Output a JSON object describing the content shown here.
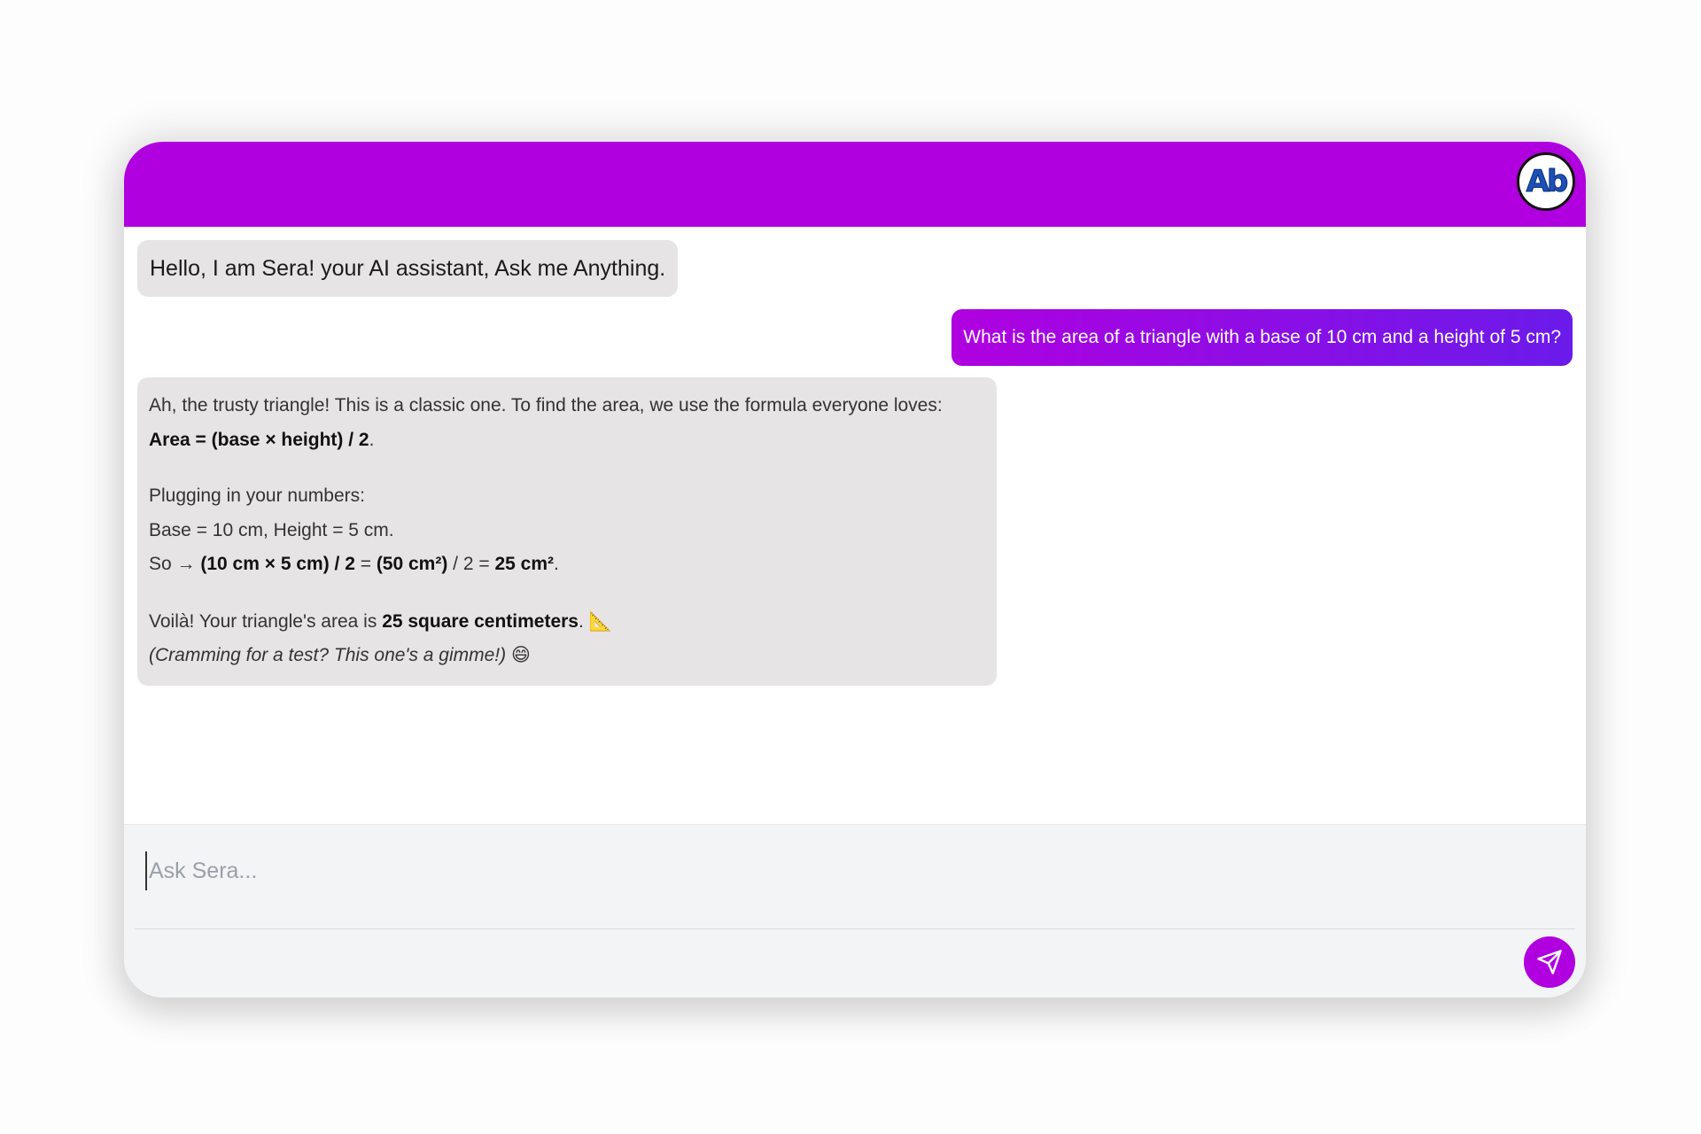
{
  "theme": {
    "header_color": "#b100e0",
    "user_bubble_gradient_start": "#b000e0",
    "user_bubble_gradient_end": "#6a1bea",
    "send_button_color": "#b000e0"
  },
  "header": {
    "avatar_text": "Ab",
    "avatar_icon": "brand-logo-icon"
  },
  "messages": {
    "greeting": "Hello, I am Sera! your AI assistant, Ask me Anything.",
    "user_question": "What is the area of a triangle with a base of 10 cm and a height of 5 cm?",
    "answer": {
      "intro": "Ah, the trusty triangle! This is a classic one. To find the area, we use the formula everyone loves:",
      "formula": "Area = (base × height) / 2",
      "formula_end": ".",
      "plug_heading": "Plugging in your numbers:",
      "plug_values": "Base = 10 cm, Height = 5 cm.",
      "so_prefix": "So → ",
      "so_bold_1": "(10 cm × 5 cm) / 2",
      "so_eq_1": " = ",
      "so_bold_2": "(50 cm²)",
      "so_div": " / 2 = ",
      "so_bold_3": "25 cm²",
      "so_end": ".",
      "voila_prefix": "Voilà! Your triangle's area is ",
      "voila_bold": "25 square centimeters",
      "voila_end": ". ",
      "voila_emoji": "📐",
      "aside": "(Cramming for a test? This one's a gimme!) ",
      "aside_emoji": "😄"
    }
  },
  "composer": {
    "placeholder": "Ask Sera...",
    "send_icon": "send-icon"
  }
}
